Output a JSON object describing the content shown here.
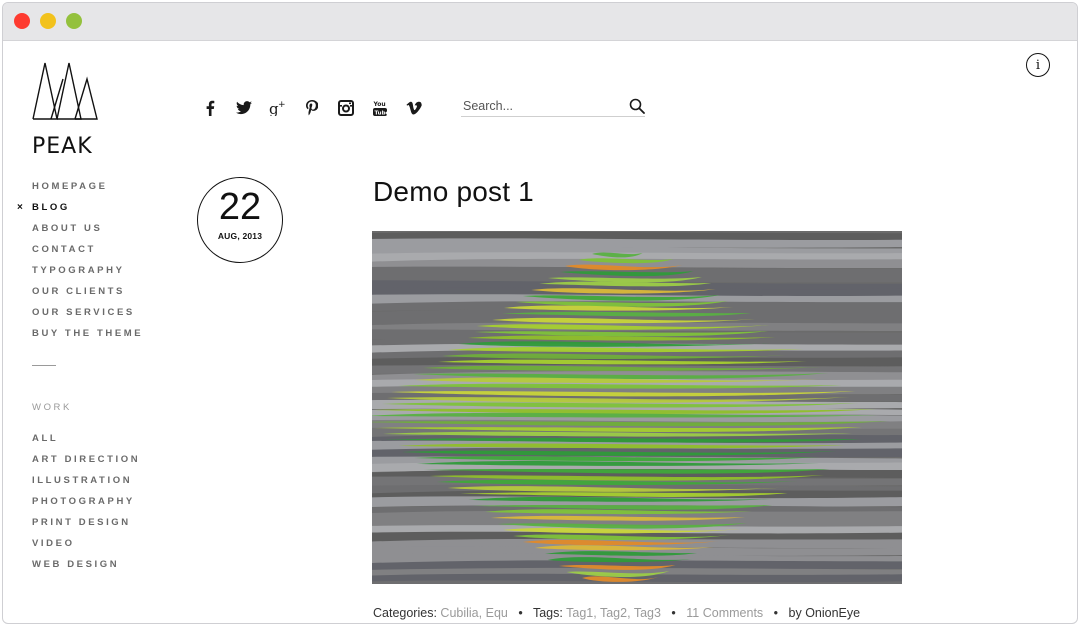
{
  "logo": {
    "text": "PEAK"
  },
  "nav": {
    "items": [
      {
        "label": "HOMEPAGE"
      },
      {
        "label": "BLOG",
        "active": true
      },
      {
        "label": "ABOUT US"
      },
      {
        "label": "CONTACT"
      },
      {
        "label": "TYPOGRAPHY"
      },
      {
        "label": "OUR CLIENTS"
      },
      {
        "label": "OUR SERVICES"
      },
      {
        "label": "BUY THE THEME"
      }
    ],
    "active_marker": "×"
  },
  "work": {
    "heading": "WORK",
    "items": [
      {
        "label": "ALL"
      },
      {
        "label": "ART DIRECTION"
      },
      {
        "label": "ILLUSTRATION"
      },
      {
        "label": "PHOTOGRAPHY"
      },
      {
        "label": "PRINT DESIGN"
      },
      {
        "label": "VIDEO"
      },
      {
        "label": "WEB DESIGN"
      }
    ]
  },
  "social": {
    "icons": [
      "facebook-icon",
      "twitter-icon",
      "google-plus-icon",
      "pinterest-icon",
      "instagram-icon",
      "youtube-icon",
      "vimeo-icon"
    ]
  },
  "search": {
    "placeholder": "Search..."
  },
  "info": {
    "symbol": "i"
  },
  "post": {
    "day": "22",
    "month": "AUG, 2013",
    "title": "Demo post 1",
    "meta": {
      "categories_label": "Categories:",
      "categories": [
        "Cubilia",
        "Equ"
      ],
      "tags_label": "Tags:",
      "tags": [
        "Tag1",
        "Tag2",
        "Tag3"
      ],
      "comments": "11 Comments",
      "author": "by OnionEye",
      "separator": "•"
    }
  },
  "colors": {
    "close": "#fe3b30",
    "minimize": "#f2c21c",
    "maximize": "#94c13d",
    "muted_link": "#9a9a9a"
  }
}
